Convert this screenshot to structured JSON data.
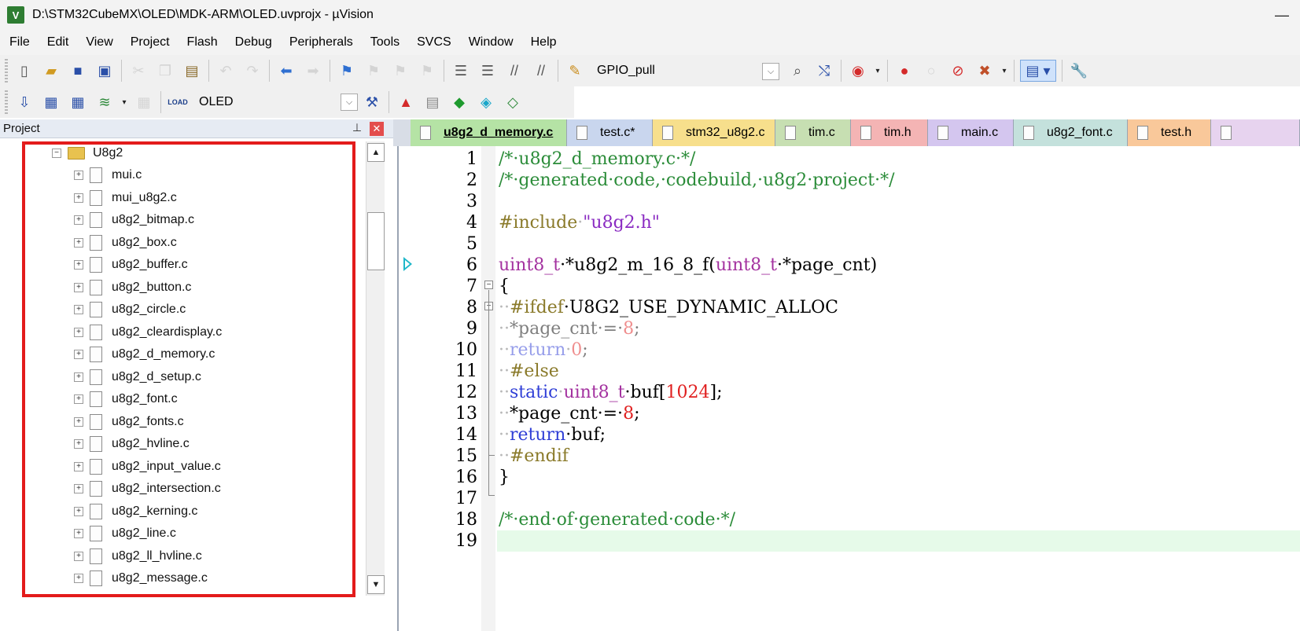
{
  "window": {
    "title": "D:\\STM32CubeMX\\OLED\\MDK-ARM\\OLED.uvprojx - µVision",
    "logo": "V",
    "minimize": "—"
  },
  "menu": [
    "File",
    "Edit",
    "View",
    "Project",
    "Flash",
    "Debug",
    "Peripherals",
    "Tools",
    "SVCS",
    "Window",
    "Help"
  ],
  "toolbar1": {
    "find_combo": "GPIO_pull"
  },
  "toolbar2": {
    "target_combo": "OLED",
    "load_label": "LOAD"
  },
  "project_panel": {
    "title": "Project",
    "folder": "U8g2",
    "files": [
      "mui.c",
      "mui_u8g2.c",
      "u8g2_bitmap.c",
      "u8g2_box.c",
      "u8g2_buffer.c",
      "u8g2_button.c",
      "u8g2_circle.c",
      "u8g2_cleardisplay.c",
      "u8g2_d_memory.c",
      "u8g2_d_setup.c",
      "u8g2_font.c",
      "u8g2_fonts.c",
      "u8g2_hvline.c",
      "u8g2_input_value.c",
      "u8g2_intersection.c",
      "u8g2_kerning.c",
      "u8g2_line.c",
      "u8g2_ll_hvline.c",
      "u8g2_message.c"
    ]
  },
  "tabs": [
    {
      "label": "u8g2_d_memory.c",
      "color": "#b5e3a5",
      "active": true
    },
    {
      "label": "test.c*",
      "color": "#c9d6ee",
      "active": false
    },
    {
      "label": "stm32_u8g2.c",
      "color": "#f7df8c",
      "active": false
    },
    {
      "label": "tim.c",
      "color": "#c7dfb2",
      "active": false
    },
    {
      "label": "tim.h",
      "color": "#f4b4b4",
      "active": false
    },
    {
      "label": "main.c",
      "color": "#d4c6ef",
      "active": false
    },
    {
      "label": "u8g2_font.c",
      "color": "#c4e1dc",
      "active": false
    },
    {
      "label": "test.h",
      "color": "#f9c89a",
      "active": false
    }
  ],
  "editor": {
    "lines": [
      "1",
      "2",
      "3",
      "4",
      "5",
      "6",
      "7",
      "8",
      "9",
      "10",
      "11",
      "12",
      "13",
      "14",
      "15",
      "16",
      "17",
      "18",
      "19"
    ],
    "code": {
      "l1": "/*·u8g2_d_memory.c·*/",
      "l2": "/*·generated·code,·codebuild,·u8g2·project·*/",
      "l4_pp": "#include",
      "l4_str": "\"u8g2.h\"",
      "l6_ty1": "uint8_t",
      "l6_mid": "·*u8g2_m_16_8_f(",
      "l6_ty2": "uint8_t",
      "l6_end": "·*page_cnt)",
      "l7": "{",
      "l8_pp": "#ifdef",
      "l8_rest": "·U8G2_USE_DYNAMIC_ALLOC",
      "l9_a": "*page_cnt",
      "l9_eq": "·=·",
      "l9_num": "8",
      "l9_end": ";",
      "l10_kw": "return",
      "l10_num": "0",
      "l10_end": ";",
      "l11_pp": "#else",
      "l12_kw": "static",
      "l12_ty": "uint8_t",
      "l12_mid": "·buf[",
      "l12_num": "1024",
      "l12_end": "];",
      "l13_a": "*page_cnt·=·",
      "l13_num": "8",
      "l13_end": ";",
      "l14_kw": "return",
      "l14_rest": "·buf;",
      "l15_pp": "#endif",
      "l16": "}",
      "l18": "/*·end·of·generated·code·*/"
    }
  }
}
